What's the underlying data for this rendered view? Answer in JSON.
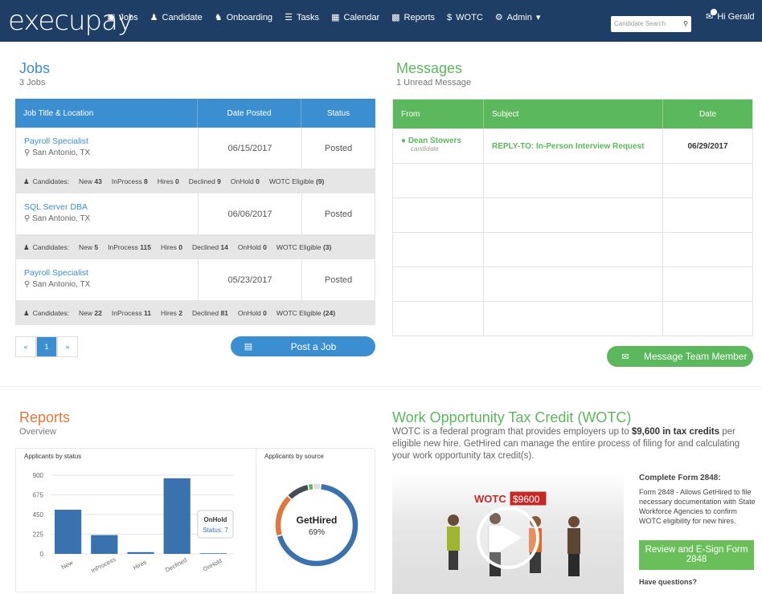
{
  "nav": {
    "logo": "execupay",
    "items": [
      {
        "icon": "briefcase-icon",
        "label": "Jobs"
      },
      {
        "icon": "user-icon",
        "label": "Candidate"
      },
      {
        "icon": "users-icon",
        "label": "Onboarding"
      },
      {
        "icon": "list-icon",
        "label": "Tasks"
      },
      {
        "icon": "calendar-icon",
        "label": "Calendar"
      },
      {
        "icon": "chart-icon",
        "label": "Reports"
      },
      {
        "icon": "dollar-icon",
        "label": "WOTC"
      },
      {
        "icon": "gears-icon",
        "label": "Admin"
      }
    ],
    "search_placeholder": "Candidate Search",
    "greeting": "Hi Gerald"
  },
  "jobs": {
    "title": "Jobs",
    "count": "3 Jobs",
    "headers": [
      "Job Title & Location",
      "Date Posted",
      "Status"
    ],
    "candidates_label": "Candidates:",
    "rows": [
      {
        "title": "Payroll Specialist",
        "location": "San Antonio, TX",
        "date": "06/15/2017",
        "status": "Posted",
        "stats": [
          [
            "New",
            "43"
          ],
          [
            "InProcess",
            "8"
          ],
          [
            "Hires",
            "0"
          ],
          [
            "Declined",
            "9"
          ],
          [
            "OnHold",
            "0"
          ],
          [
            "WOTC Eligible",
            "(9)"
          ]
        ]
      },
      {
        "title": "SQL Server DBA",
        "location": "San Antonio, TX",
        "date": "06/06/2017",
        "status": "Posted",
        "stats": [
          [
            "New",
            "5"
          ],
          [
            "InProcess",
            "115"
          ],
          [
            "Hires",
            "0"
          ],
          [
            "Declined",
            "14"
          ],
          [
            "OnHold",
            "0"
          ],
          [
            "WOTC Eligible",
            "(3)"
          ]
        ]
      },
      {
        "title": "Payroll Specialist",
        "location": "San Antonio, TX",
        "date": "05/23/2017",
        "status": "Posted",
        "stats": [
          [
            "New",
            "22"
          ],
          [
            "InProcess",
            "11"
          ],
          [
            "Hires",
            "2"
          ],
          [
            "Declined",
            "81"
          ],
          [
            "OnHold",
            "0"
          ],
          [
            "WOTC Eligible",
            "(24)"
          ]
        ]
      }
    ],
    "pager": [
      "«",
      "1",
      "»"
    ],
    "post_button": "Post a Job"
  },
  "messages": {
    "title": "Messages",
    "count": "1 Unread Message",
    "headers": [
      "From",
      "Subject",
      "Date"
    ],
    "rows": [
      {
        "from": "Dean Stowers",
        "role": "candidate",
        "subject": "REPLY-TO: In-Person Interview Request",
        "date": "06/29/2017"
      }
    ],
    "button": "Message Team Member"
  },
  "reports": {
    "title": "Reports",
    "subtitle": "Overview",
    "bar_title": "Applicants by status",
    "donut_title": "Applicants by source",
    "tooltip_title": "OnHold",
    "tooltip_value": "Status: 7",
    "donut_label": "GetHired",
    "donut_value": "69%"
  },
  "chart_data": [
    {
      "type": "bar",
      "title": "Applicants by status",
      "categories": [
        "New",
        "InProcess",
        "Hires",
        "Declined",
        "OnHold"
      ],
      "values": [
        505,
        215,
        20,
        865,
        7
      ],
      "yticks": [
        0,
        225,
        450,
        675,
        900
      ],
      "ylim": [
        0,
        900
      ],
      "color": "#3a72b0"
    },
    {
      "type": "pie",
      "title": "Applicants by source",
      "slices": [
        {
          "label": "GetHired",
          "value": 69,
          "color": "#3a72b0"
        },
        {
          "label": "",
          "value": 17,
          "color": "#e0773c"
        },
        {
          "label": "",
          "value": 9,
          "color": "#444c54"
        },
        {
          "label": "",
          "value": 2,
          "color": "#5cb85c"
        },
        {
          "label": "",
          "value": 3,
          "color": "#dddddd"
        }
      ]
    }
  ],
  "wotc": {
    "title": "Work Opportunity Tax Credit (WOTC)",
    "text_pre": "WOTC is a federal program that provides employers up to ",
    "text_bold": "$9,600 in tax credits",
    "text_post": " per eligible new hire. GetHired can manage the entire process of filing for and calculating your work opportunity tax credit(s).",
    "video_label": "WOTC",
    "video_amount": "$9600",
    "form_title": "Complete Form 2848:",
    "form_text": "Form 2848 - Allows GetHired to file necessary documentation with State Workforce Agencies to confirm WOTC eligibility for new hires.",
    "esign_button": "Review and E-Sign Form 2848",
    "questions": "Have questions?"
  }
}
